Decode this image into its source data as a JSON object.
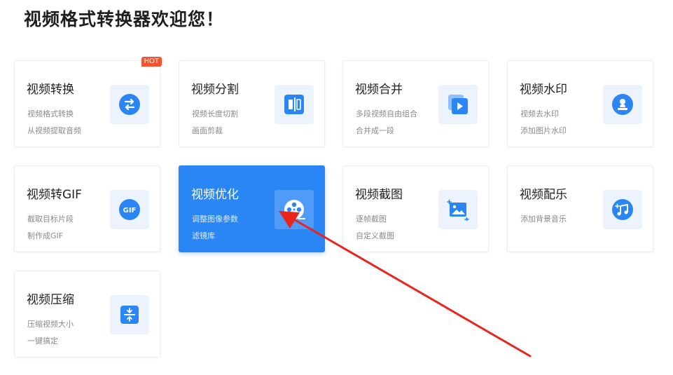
{
  "page": {
    "title": "视频格式转换器欢迎您！"
  },
  "cards": [
    {
      "name": "视频转换",
      "desc1": "视频格式转换",
      "desc2": "从视频提取音频",
      "badge": "HOT",
      "icon": "swap-icon"
    },
    {
      "name": "视频分割",
      "desc1": "视频长度切割",
      "desc2": "画面剪裁",
      "icon": "split-icon"
    },
    {
      "name": "视频合并",
      "desc1": "多段视频自由组合",
      "desc2": "合并成一段",
      "icon": "merge-icon"
    },
    {
      "name": "视频水印",
      "desc1": "视频去水印",
      "desc2": "添加图片水印",
      "icon": "watermark-icon"
    },
    {
      "name": "视频转GIF",
      "desc1": "截取目标片段",
      "desc2": "制作成GIF",
      "icon": "gif-icon",
      "icon_text": "GIF"
    },
    {
      "name": "视频优化",
      "desc1": "调整图像参数",
      "desc2": "滤镜库",
      "icon": "film-reel-icon",
      "active": true
    },
    {
      "name": "视频截图",
      "desc1": "逐帧截图",
      "desc2": "自定义截图",
      "icon": "screenshot-icon"
    },
    {
      "name": "视频配乐",
      "desc1": "添加背景音乐",
      "desc2": "",
      "icon": "music-icon"
    },
    {
      "name": "视频压缩",
      "desc1": "压缩视频大小",
      "desc2": "一键搞定",
      "icon": "compress-icon"
    }
  ],
  "colors": {
    "accent": "#2a86f5",
    "icon_bg": "#ecf3fd",
    "hot_badge": "#f5532f",
    "annotation_arrow": "#e8261f"
  }
}
